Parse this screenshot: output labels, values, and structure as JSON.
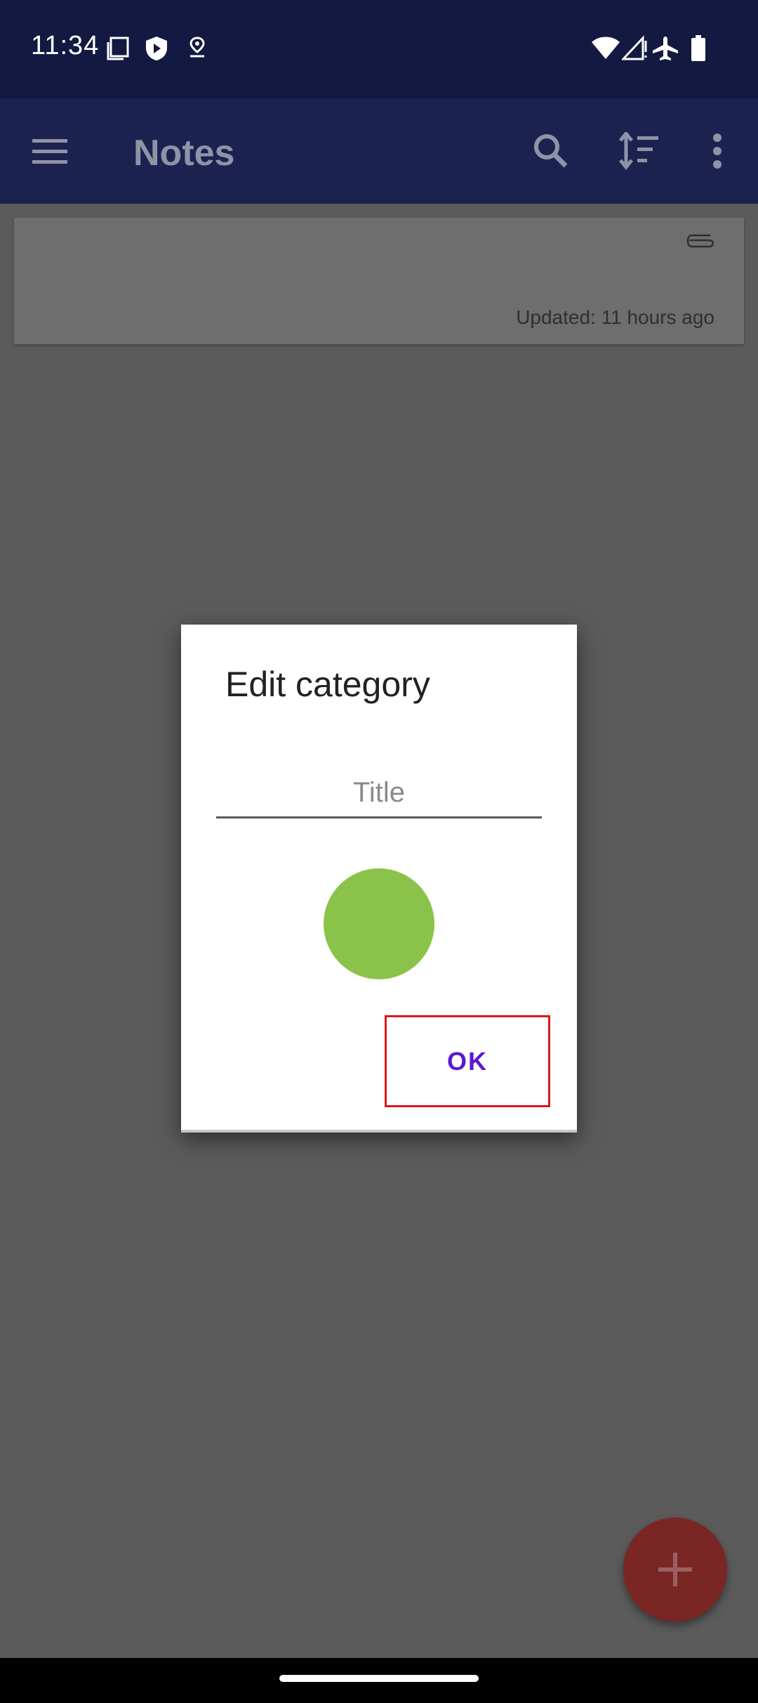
{
  "status_bar": {
    "time": "11:34",
    "left_icons": [
      "screenshot-icon",
      "shield-icon",
      "location-pin-icon"
    ],
    "right_icons": [
      "wifi-icon",
      "cell-signal-icon",
      "airplane-icon",
      "battery-icon"
    ]
  },
  "app_bar": {
    "title": "Notes",
    "icons": [
      "menu-icon",
      "search-icon",
      "sort-icon",
      "more-vert-icon"
    ]
  },
  "note": {
    "updated": "Updated: 11 hours ago",
    "icon": "paperclip-icon"
  },
  "dialog": {
    "title": "Edit category",
    "title_placeholder": "Title",
    "title_value": "",
    "color": "#8bc34a",
    "ok_label": "OK"
  },
  "fab": {
    "icon": "plus-icon",
    "color": "#7a2625"
  },
  "colors": {
    "status_bar": "#131940",
    "app_bar": "#1c2250",
    "scrim": "#5b5b5b",
    "ok_text": "#5a18d6",
    "highlight_border": "#e0161b"
  }
}
